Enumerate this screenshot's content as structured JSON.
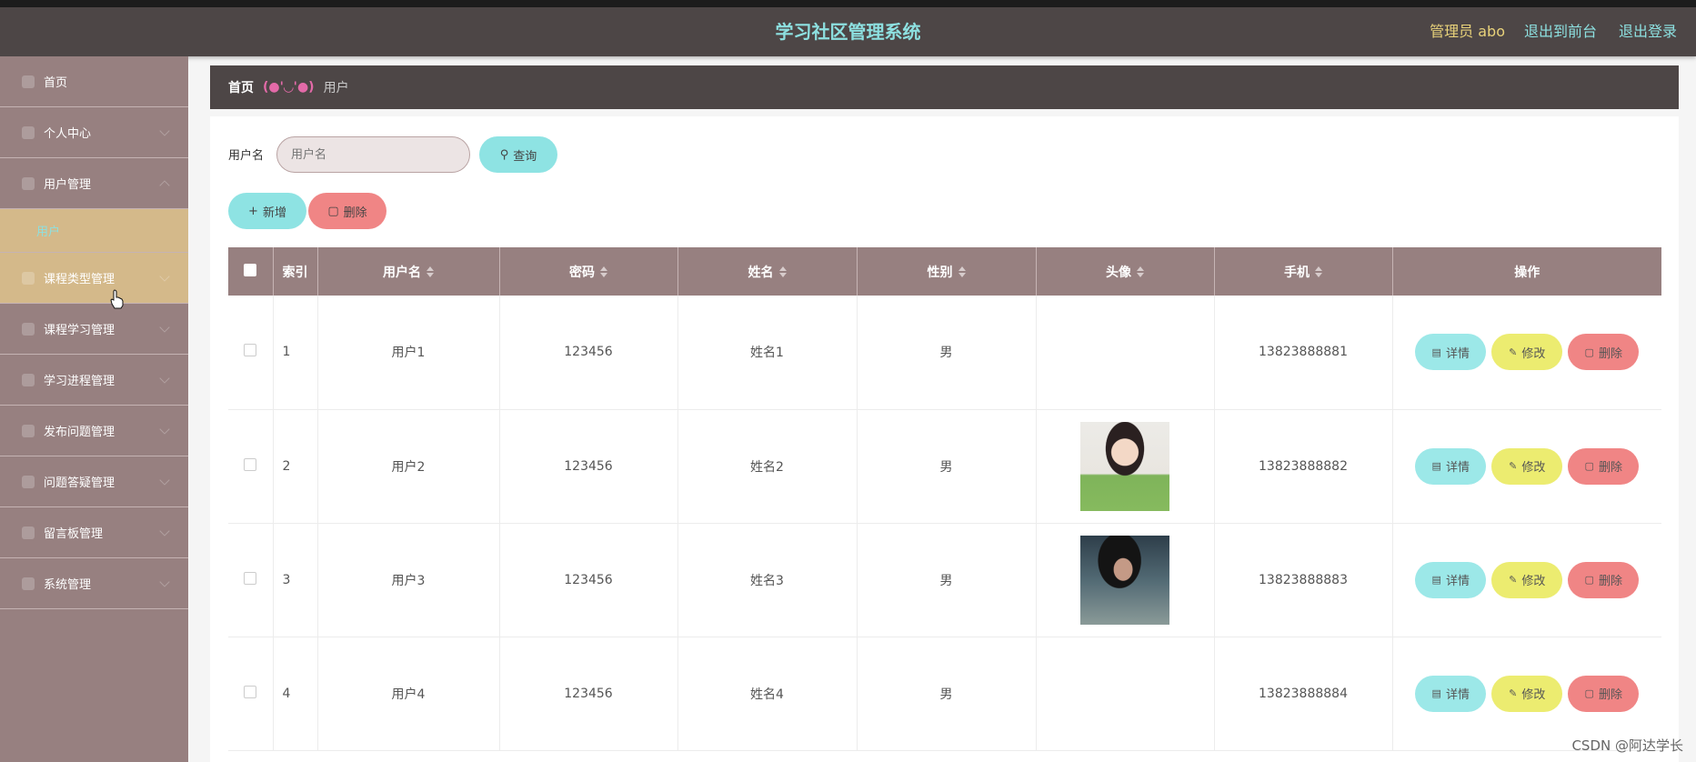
{
  "header": {
    "title": "学习社区管理系统",
    "admin_label": "管理员 abo",
    "to_front": "退出到前台",
    "logout": "退出登录"
  },
  "sidebar": {
    "items": [
      {
        "label": "首页",
        "icon": "home-icon"
      },
      {
        "label": "个人中心",
        "icon": "user-icon"
      },
      {
        "label": "用户管理",
        "icon": "list-icon"
      },
      {
        "label": "用户",
        "icon": ""
      },
      {
        "label": "课程类型管理",
        "icon": "globe-icon"
      },
      {
        "label": "课程学习管理",
        "icon": "compass-icon"
      },
      {
        "label": "学习进程管理",
        "icon": "gear-icon"
      },
      {
        "label": "发布问题管理",
        "icon": "flag-icon"
      },
      {
        "label": "问题答疑管理",
        "icon": "message-icon"
      },
      {
        "label": "留言板管理",
        "icon": "menu-icon"
      },
      {
        "label": "系统管理",
        "icon": "chart-icon"
      }
    ]
  },
  "breadcrumb": {
    "home": "首页",
    "separator": "(●'◡'●)",
    "current": "用户"
  },
  "search": {
    "label": "用户名",
    "placeholder": "用户名",
    "query_button": "查询"
  },
  "actions": {
    "add": "新增",
    "delete": "删除"
  },
  "table": {
    "columns": [
      "索引",
      "用户名",
      "密码",
      "姓名",
      "性别",
      "头像",
      "手机",
      "操作"
    ],
    "rows": [
      {
        "index": "1",
        "username": "用户1",
        "password": "123456",
        "name": "姓名1",
        "gender": "男",
        "phone": "13823888881"
      },
      {
        "index": "2",
        "username": "用户2",
        "password": "123456",
        "name": "姓名2",
        "gender": "男",
        "phone": "13823888882"
      },
      {
        "index": "3",
        "username": "用户3",
        "password": "123456",
        "name": "姓名3",
        "gender": "男",
        "phone": "13823888883"
      },
      {
        "index": "4",
        "username": "用户4",
        "password": "123456",
        "name": "姓名4",
        "gender": "男",
        "phone": "13823888884"
      }
    ],
    "ops": {
      "detail": "详情",
      "edit": "修改",
      "delete": "删除"
    }
  },
  "watermark": "CSDN @阿达学长",
  "colors": {
    "header_bg": "#4d4646",
    "sidebar_bg": "#978080",
    "accent_cyan": "#8ee3e3",
    "accent_red": "#f08585",
    "accent_yellow": "#ecec70",
    "active_menu": "#d4b98a"
  }
}
